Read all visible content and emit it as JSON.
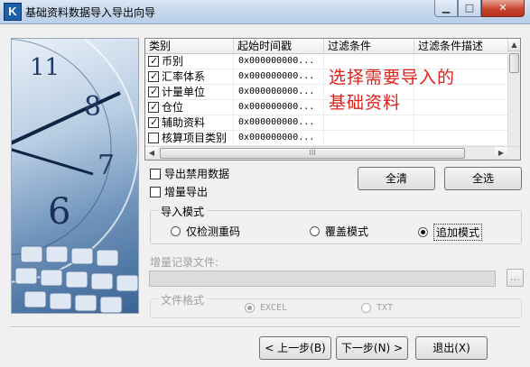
{
  "window": {
    "title": "基础资料数据导入导出向导",
    "app_icon": "K",
    "minimize_icon": "minimize-icon",
    "maximize_icon": "maximize-icon",
    "close_icon": "close-icon"
  },
  "grid": {
    "columns": [
      "类别",
      "起始时间戳",
      "过滤条件",
      "过滤条件描述"
    ],
    "rows": [
      {
        "category": "币别",
        "timestamp": "0x000000000...",
        "checked": true
      },
      {
        "category": "汇率体系",
        "timestamp": "0x000000000...",
        "checked": true
      },
      {
        "category": "计量单位",
        "timestamp": "0x000000000...",
        "checked": true
      },
      {
        "category": "仓位",
        "timestamp": "0x000000000...",
        "checked": true
      },
      {
        "category": "辅助资料",
        "timestamp": "0x000000000...",
        "checked": true
      },
      {
        "category": "核算项目类别",
        "timestamp": "0x000000000...",
        "checked": false
      }
    ],
    "scroll_grip": "III"
  },
  "annotation": "选择需要导入的基础资料",
  "options": {
    "export_disabled": {
      "label": "导出禁用数据",
      "checked": false
    },
    "incremental_export": {
      "label": "增量导出",
      "checked": false
    }
  },
  "buttons": {
    "clear_all": "全清",
    "select_all": "全选",
    "prev": "< 上一步(B)",
    "next": "下一步(N) >",
    "exit": "退出(X)",
    "browse": "..."
  },
  "import_mode": {
    "legend": "导入模式",
    "options": [
      "仅检测重码",
      "覆盖模式",
      "追加模式"
    ],
    "selected": "追加模式"
  },
  "incremental_file": {
    "label": "增量记录文件:",
    "value": ""
  },
  "file_format": {
    "legend": "文件格式",
    "options": [
      "EXCEL",
      "TXT"
    ],
    "selected": "EXCEL"
  }
}
